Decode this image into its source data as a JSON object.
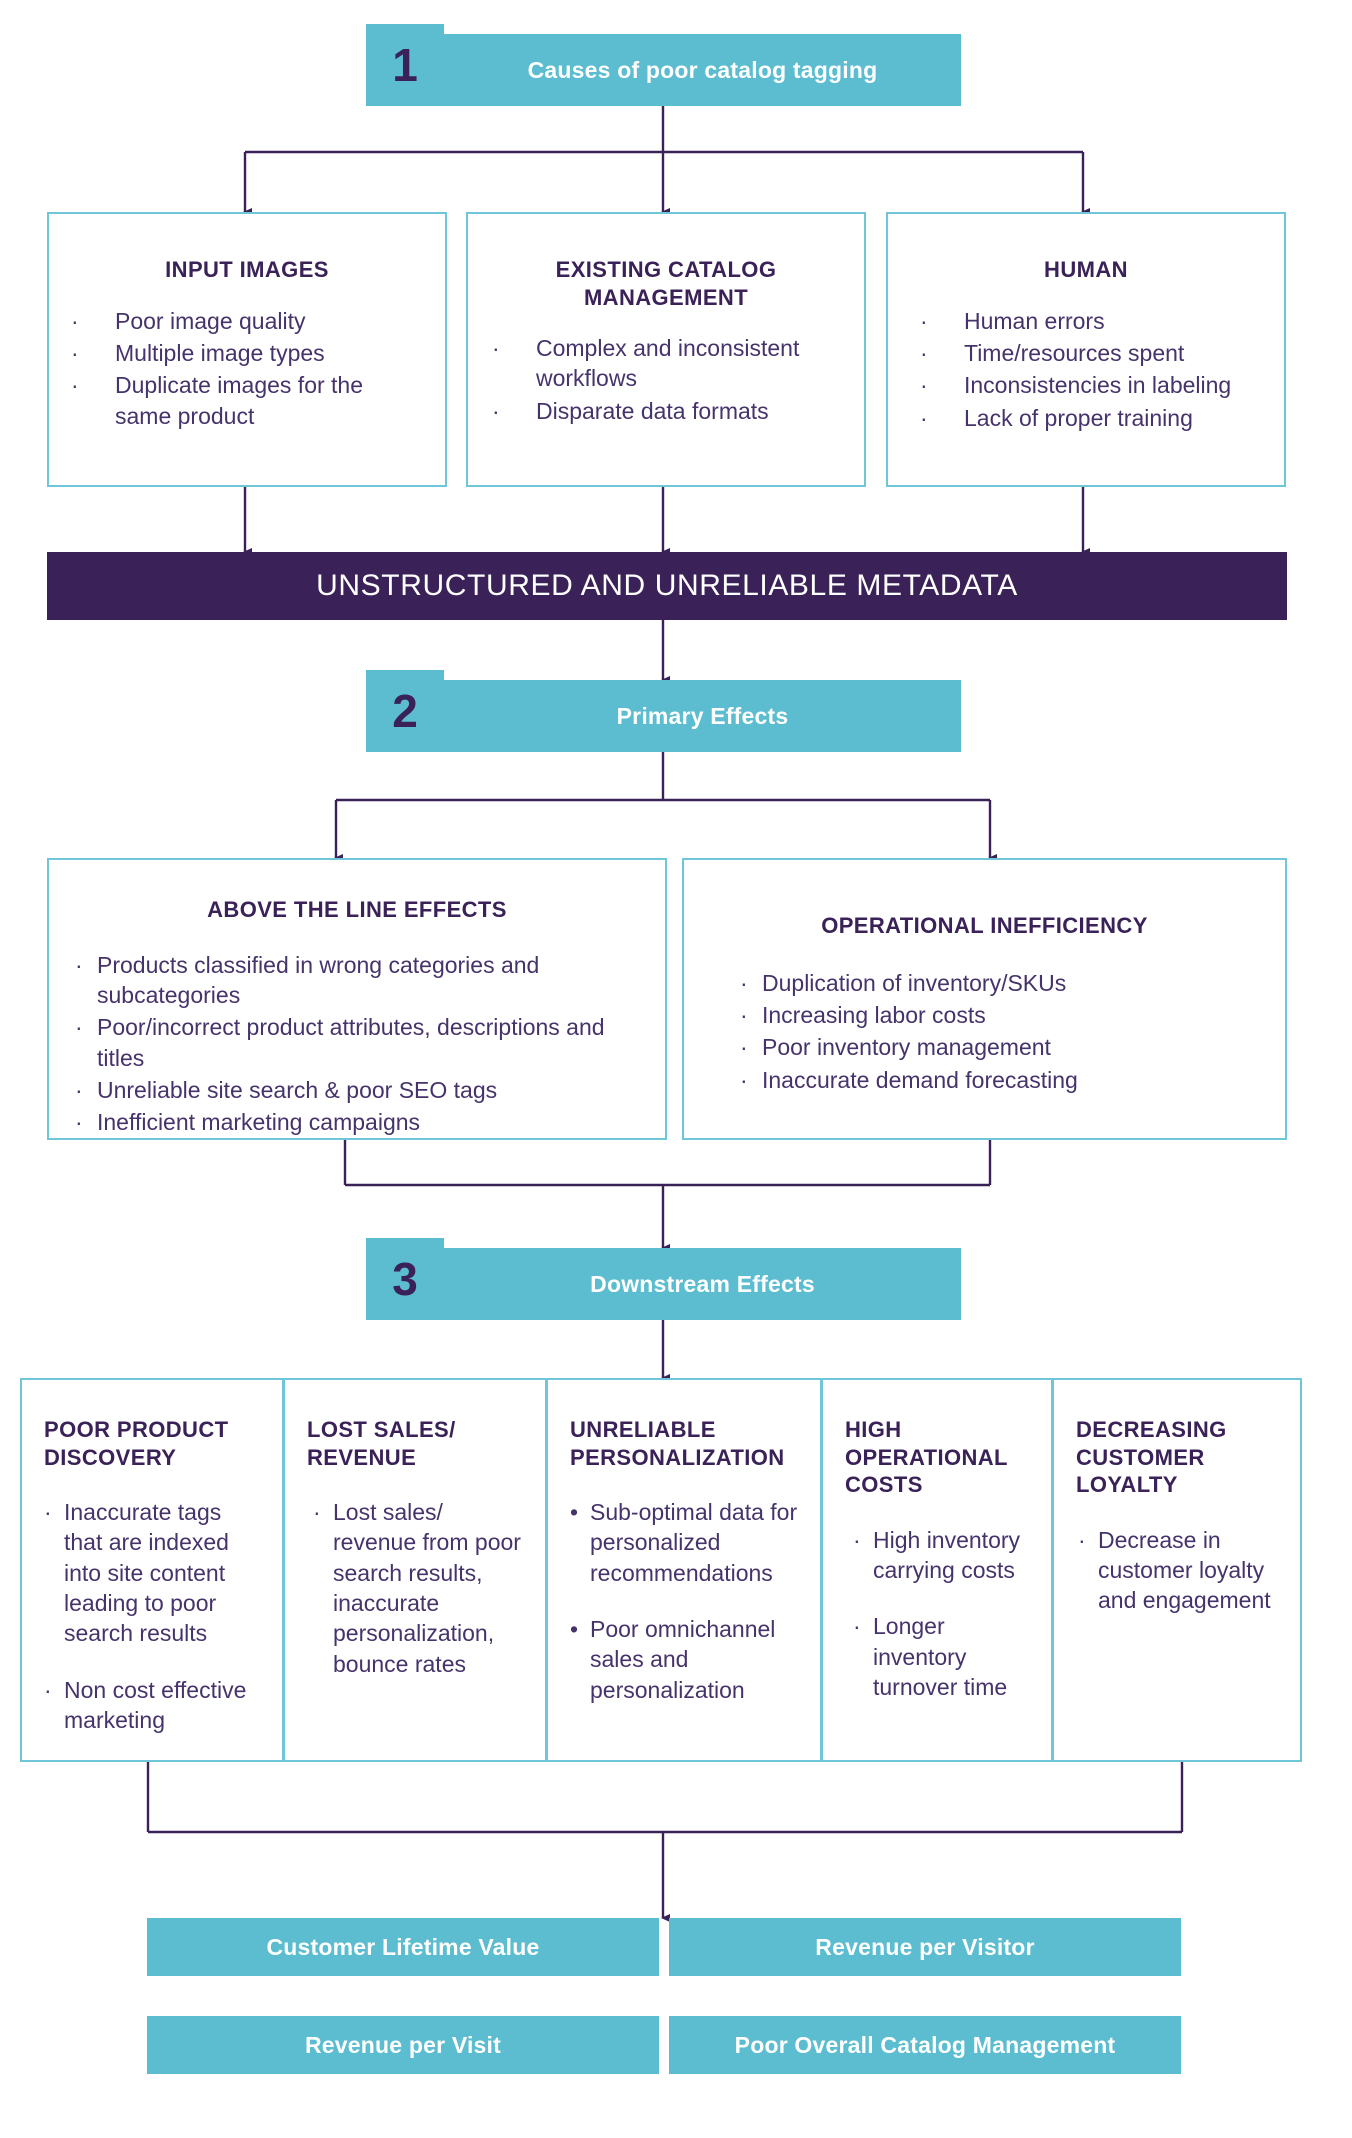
{
  "colors": {
    "teal": "#5BBDCF",
    "teal_border": "#6FC6D6",
    "purple": "#3A2259",
    "body_text": "#46336b",
    "white": "#FFFFFF"
  },
  "steps": [
    {
      "number": "1",
      "title": "Causes of poor catalog tagging"
    },
    {
      "number": "2",
      "title": "Primary Effects"
    },
    {
      "number": "3",
      "title": "Downstream Effects"
    }
  ],
  "causes": [
    {
      "title": "INPUT IMAGES",
      "bullets": [
        "Poor image quality",
        "Multiple image types",
        "Duplicate images for the same product"
      ]
    },
    {
      "title": "EXISTING CATALOG MANAGEMENT",
      "bullets": [
        "Complex and inconsistent workflows",
        "Disparate data formats"
      ]
    },
    {
      "title": "HUMAN",
      "bullets": [
        "Human errors",
        "Time/resources spent",
        "Inconsistencies in labeling",
        "Lack of proper training"
      ]
    }
  ],
  "metadata_bar": "UNSTRUCTURED AND UNRELIABLE METADATA",
  "primary_effects": [
    {
      "title": "ABOVE THE LINE EFFECTS",
      "bullets": [
        "Products classified in wrong categories and subcategories",
        "Poor/incorrect product attributes, descriptions and titles",
        "Unreliable site search & poor SEO tags",
        "Inefficient marketing campaigns"
      ]
    },
    {
      "title": "OPERATIONAL INEFFICIENCY",
      "bullets": [
        "Duplication of inventory/SKUs",
        "Increasing labor costs",
        "Poor inventory management",
        "Inaccurate demand forecasting"
      ]
    }
  ],
  "downstream_effects": [
    {
      "title": "POOR PRODUCT DISCOVERY",
      "bullets": [
        "Inaccurate tags that are indexed into site content leading to poor search results",
        "Non cost effective marketing"
      ]
    },
    {
      "title": "LOST SALES/ REVENUE",
      "bullets": [
        "Lost sales/ revenue from poor search results, inaccurate personalization, bounce rates"
      ]
    },
    {
      "title": "UNRELIABLE PERSONALIZATION",
      "bullets": [
        "Sub-optimal data for personalized recommendations",
        "Poor omnichannel sales and personalization"
      ]
    },
    {
      "title": "HIGH OPERATIONAL COSTS",
      "bullets": [
        "High inventory carrying costs",
        "Longer inventory turnover time"
      ]
    },
    {
      "title": "DECREASING CUSTOMER LOYALTY",
      "bullets": [
        "Decrease in customer loyalty and engagement"
      ]
    }
  ],
  "outcomes": [
    "Customer Lifetime Value",
    "Revenue per Visitor",
    "Revenue per Visit",
    "Poor Overall Catalog Management"
  ]
}
